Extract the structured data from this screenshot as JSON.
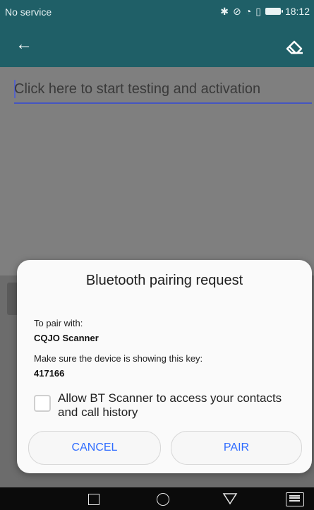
{
  "status_bar": {
    "left_text": "No service",
    "time": "18:12",
    "icons": [
      "bluetooth-icon",
      "mute-icon",
      "wifi-icon",
      "phone-icon",
      "battery-icon"
    ]
  },
  "toolbar": {
    "back_icon": "arrow-left-icon",
    "clear_icon": "eraser-icon"
  },
  "input": {
    "placeholder": "Click here to start testing and activation"
  },
  "dialog": {
    "title": "Bluetooth pairing request",
    "pair_with_label": "To pair with:",
    "device_name": "CQJO Scanner",
    "key_label": "Make sure the device is showing this key:",
    "key_value": "417166",
    "checkbox_label": "Allow BT Scanner to access your contacts and call history",
    "cancel_label": "CANCEL",
    "pair_label": "PAIR"
  },
  "navigation_bar": {
    "items": [
      "recent-apps-icon",
      "home-icon",
      "back-icon",
      "keyboard-icon"
    ]
  },
  "colors": {
    "toolbar": "#1f5f67",
    "dialog_button_text": "#2f6cff",
    "input_underline": "#4455c2"
  }
}
